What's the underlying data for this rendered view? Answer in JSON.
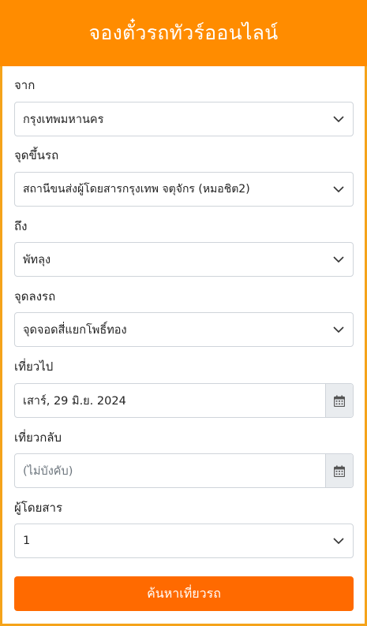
{
  "header": {
    "title": "จองตั๋วรถทัวร์ออนไลน์"
  },
  "form": {
    "from": {
      "label": "จาก",
      "value": "กรุงเทพมหานคร"
    },
    "pickup": {
      "label": "จุดขึ้นรถ",
      "value": "สถานีขนส่งผู้โดยสารกรุงเทพ จตุจักร (หมอชิต2)"
    },
    "to": {
      "label": "ถึง",
      "value": "พัทลุง"
    },
    "dropoff": {
      "label": "จุดลงรถ",
      "value": "จุดจอดสี่แยกโพธิ์ทอง"
    },
    "depart": {
      "label": "เที่ยวไป",
      "value": "เสาร์, 29 มิ.ย. 2024"
    },
    "return": {
      "label": "เที่ยวกลับ",
      "placeholder": "(ไม่บังคับ)"
    },
    "passengers": {
      "label": "ผู้โดยสาร",
      "value": "1"
    },
    "search_label": "ค้นหาเที่ยวรถ"
  },
  "colors": {
    "header": "#ff8c00",
    "button": "#ff6a00",
    "border": "#f5a31a"
  },
  "icons": {
    "select": "chevron-down-icon",
    "date": "calendar-icon"
  }
}
